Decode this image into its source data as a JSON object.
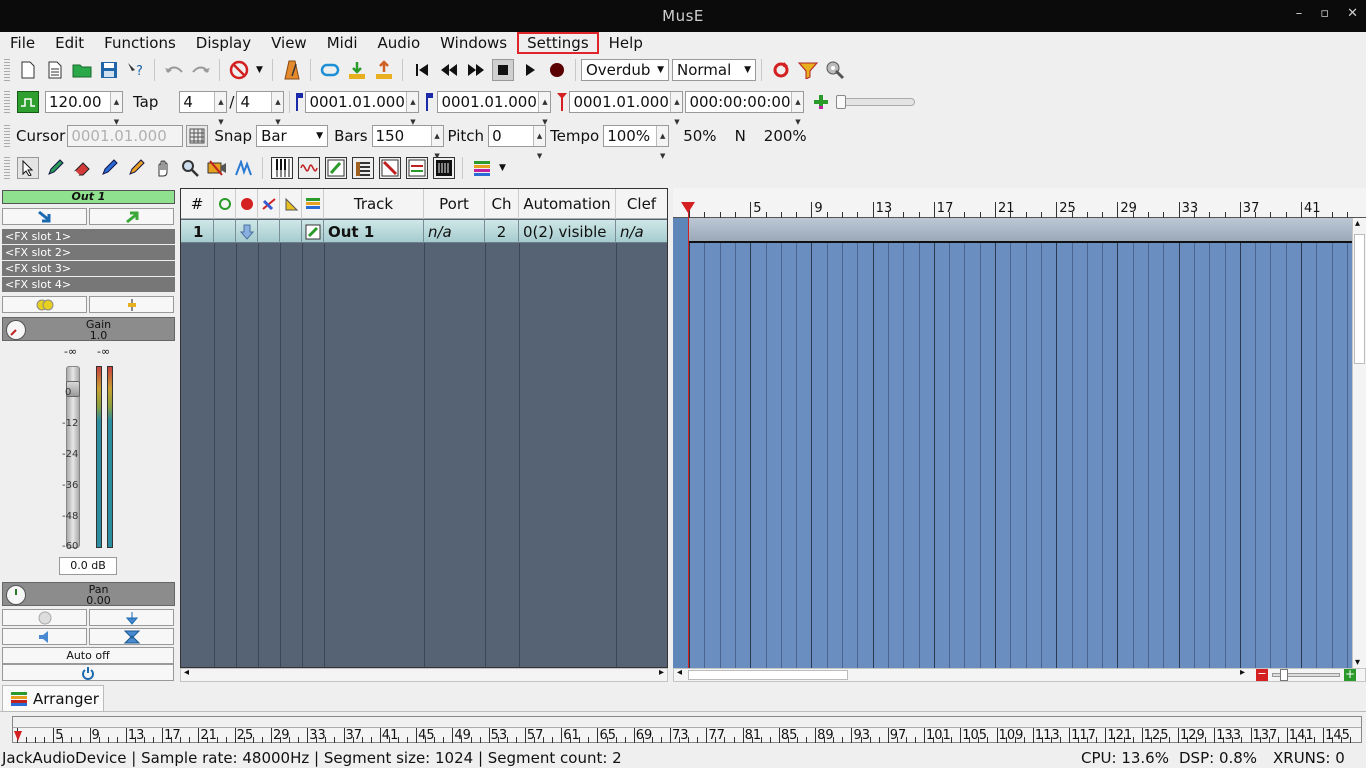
{
  "window": {
    "title": "MusE"
  },
  "menu": [
    "File",
    "Edit",
    "Functions",
    "Display",
    "View",
    "Midi",
    "Audio",
    "Windows",
    "Settings",
    "Help"
  ],
  "toolbar1": {
    "record_mode": "Overdub",
    "cycle_mode": "Normal"
  },
  "toolbar2": {
    "tempo": "120.00",
    "tap_label": "Tap",
    "sig_num": "4",
    "sig_slash": "/",
    "sig_den": "4",
    "left_marker": "0001.01.000",
    "right_marker": "0001.01.000",
    "position": "0001.01.000",
    "time": "000:00:00:00"
  },
  "toolbar3": {
    "cursor_label": "Cursor",
    "cursor_value": "0001.01.000",
    "snap_label": "Snap",
    "snap_value": "Bar",
    "bars_label": "Bars",
    "bars_value": "150",
    "pitch_label": "Pitch",
    "pitch_value": "0",
    "tempo_label": "Tempo",
    "tempo_value": "100%",
    "z50": "50%",
    "zn": "N",
    "z200": "200%"
  },
  "strip": {
    "name": "Out 1",
    "fx": [
      "<FX slot 1>",
      "<FX slot 2>",
      "<FX slot 3>",
      "<FX slot 4>"
    ],
    "gain_label": "Gain",
    "gain_value": "1.0",
    "peak_l": "-∞",
    "peak_r": "-∞",
    "scale": [
      "0",
      "-12",
      "-24",
      "-36",
      "-48",
      "-60"
    ],
    "db": "0.0 dB",
    "pan_label": "Pan",
    "pan_value": "0.00",
    "auto": "Auto off"
  },
  "tracklist": {
    "headers": {
      "num": "#",
      "track": "Track",
      "port": "Port",
      "ch": "Ch",
      "automation": "Automation",
      "clef": "Clef"
    },
    "row": {
      "num": "1",
      "name": "Out 1",
      "port": "n/a",
      "ch": "2",
      "automation": "0(2) visible",
      "clef": "n/a"
    }
  },
  "ruler_top": [
    "5",
    "9",
    "13",
    "17",
    "21",
    "25",
    "29",
    "33",
    "37",
    "41"
  ],
  "ruler_bottom": [
    "5",
    "9",
    "13",
    "17",
    "21",
    "25",
    "29",
    "33",
    "37",
    "41",
    "45",
    "49",
    "53",
    "57",
    "61",
    "65",
    "69",
    "73",
    "77",
    "81",
    "85",
    "89",
    "93",
    "97",
    "101",
    "105",
    "109",
    "113",
    "117",
    "121",
    "125",
    "129",
    "133",
    "137",
    "141",
    "145"
  ],
  "tab": "Arranger",
  "status": {
    "device": "JackAudioDevice | Sample rate: 48000Hz | Segment size: 1024 | Segment count: 2",
    "cpu": "CPU: 13.6%",
    "dsp": "DSP: 0.8%",
    "xruns": "XRUNS: 0"
  }
}
